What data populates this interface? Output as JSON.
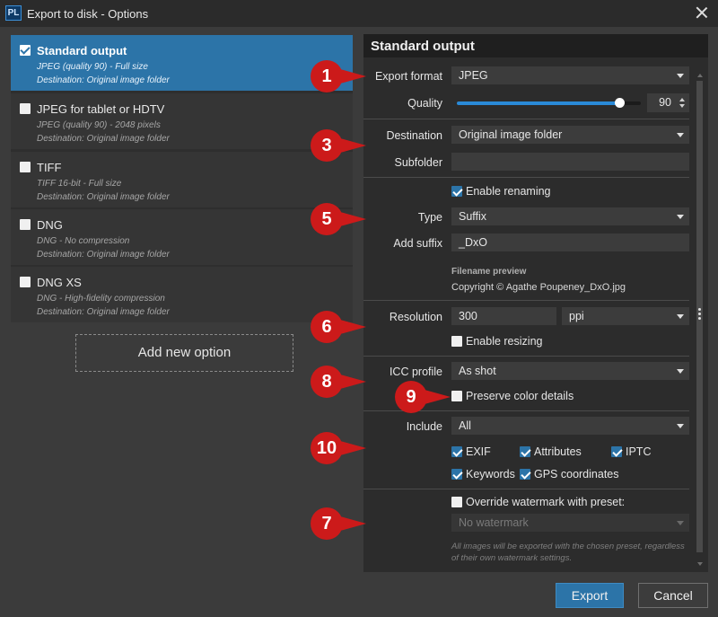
{
  "window": {
    "app_icon": "PL",
    "title": "Export to disk - Options"
  },
  "options": [
    {
      "name": "Standard output",
      "line1": "JPEG (quality 90) - Full size",
      "line2": "Destination: Original image folder",
      "selected": true,
      "checked": true
    },
    {
      "name": "JPEG for tablet or HDTV",
      "line1": "JPEG (quality 90) - 2048 pixels",
      "line2": "Destination: Original image folder",
      "selected": false,
      "checked": false
    },
    {
      "name": "TIFF",
      "line1": "TIFF 16-bit - Full size",
      "line2": "Destination: Original image folder",
      "selected": false,
      "checked": false
    },
    {
      "name": "DNG",
      "line1": "DNG - No compression",
      "line2": "Destination: Original image folder",
      "selected": false,
      "checked": false
    },
    {
      "name": "DNG XS",
      "line1": "DNG - High-fidelity compression",
      "line2": "Destination: Original image folder",
      "selected": false,
      "checked": false
    }
  ],
  "add_option_label": "Add new option",
  "panel": {
    "title": "Standard output",
    "export_format": {
      "label": "Export format",
      "value": "JPEG"
    },
    "quality": {
      "label": "Quality",
      "value": "90",
      "fraction": 0.9
    },
    "destination": {
      "label": "Destination",
      "value": "Original image folder"
    },
    "subfolder": {
      "label": "Subfolder",
      "value": ""
    },
    "renaming": {
      "label": "Enable renaming",
      "checked": true
    },
    "type": {
      "label": "Type",
      "value": "Suffix"
    },
    "add_suffix": {
      "label": "Add suffix",
      "value": "_DxO"
    },
    "filename_preview": {
      "label": "Filename preview",
      "value": "Copyright © Agathe Poupeney_DxO.jpg"
    },
    "resolution": {
      "label": "Resolution",
      "value": "300",
      "unit": "ppi"
    },
    "resizing": {
      "label": "Enable resizing",
      "checked": false
    },
    "icc_profile": {
      "label": "ICC profile",
      "value": "As shot"
    },
    "preserve_color": {
      "label": "Preserve color details",
      "checked": false
    },
    "include": {
      "label": "Include",
      "value": "All",
      "exif": "EXIF",
      "attributes": "Attributes",
      "iptc": "IPTC",
      "keywords": "Keywords",
      "gps": "GPS coordinates"
    },
    "watermark": {
      "override_label": "Override watermark with preset:",
      "value": "No watermark",
      "note": "All images will be exported with the chosen preset, regardless of their own watermark settings."
    }
  },
  "badges": [
    "1",
    "3",
    "5",
    "6",
    "8",
    "9",
    "10",
    "7"
  ],
  "badge_color": "#cc1a1a",
  "accent_color": "#2c74a8",
  "buttons": {
    "export": "Export",
    "cancel": "Cancel"
  }
}
